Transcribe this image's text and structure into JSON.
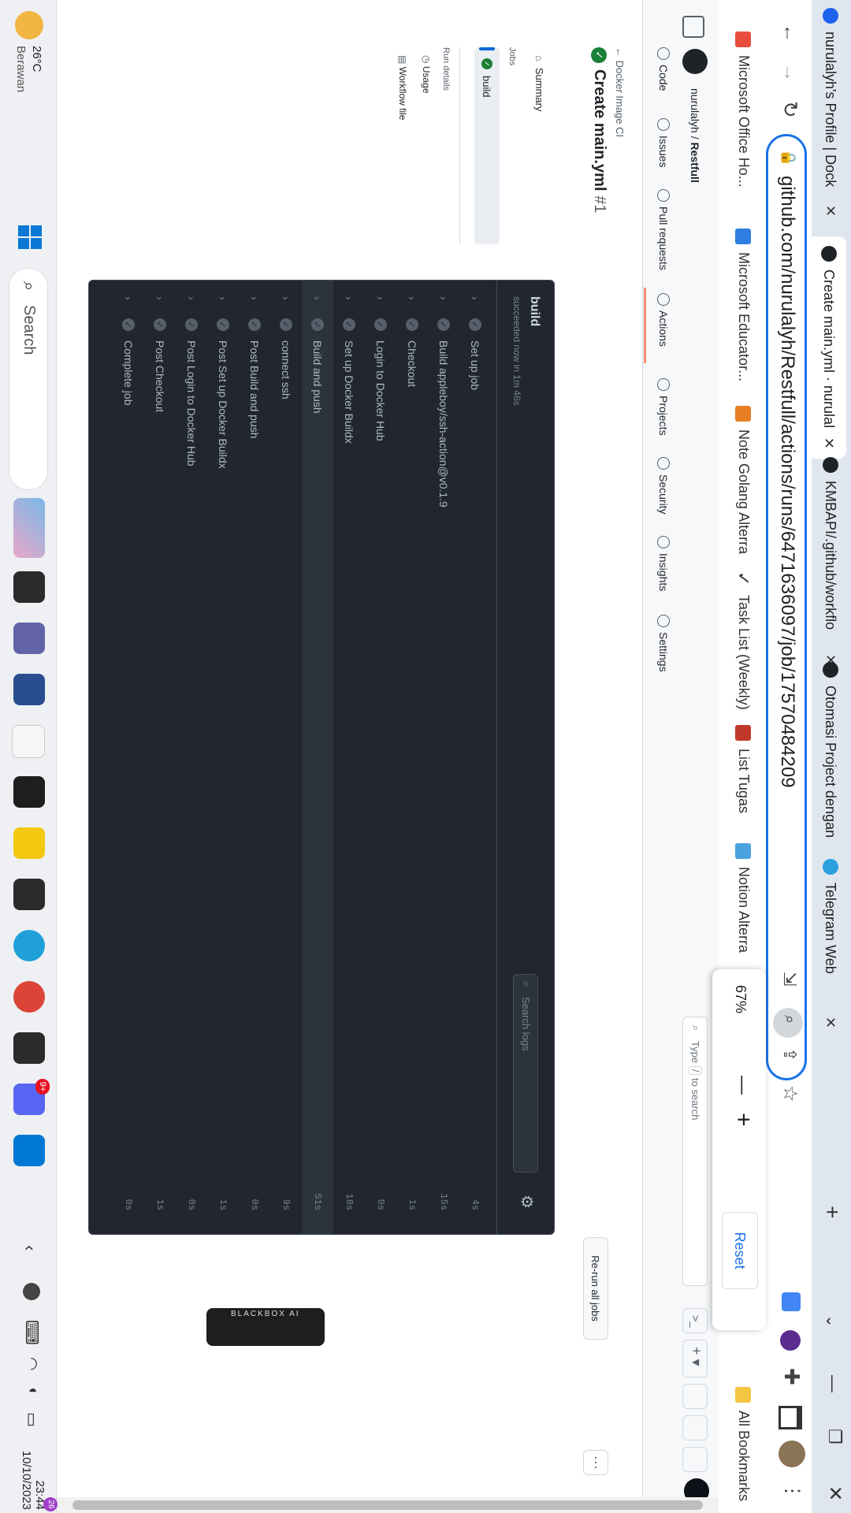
{
  "browser": {
    "tabs": [
      {
        "title": "nurulalyh's Profile | Dock",
        "active": false
      },
      {
        "title": "Create main.yml · nurulal",
        "active": true
      },
      {
        "title": "KMBAPI/.github/workflo",
        "active": false
      },
      {
        "title": "Otomasi Project dengan",
        "active": false
      },
      {
        "title": "Telegram Web",
        "active": false
      }
    ],
    "new_tab": "+",
    "url": "github.com/nurulalyh/Restfull/actions/runs/6471636097/job/17570484209",
    "bookmarks": [
      {
        "label": "Microsoft Office Ho...",
        "color": "#e74c3c"
      },
      {
        "label": "Microsoft Educator...",
        "color": "#2f7de1"
      },
      {
        "label": "Note Golang Alterra",
        "color": "#e67e22"
      },
      {
        "label": "Task List (Weekly)",
        "color": "#333333"
      },
      {
        "label": "List Tugas",
        "color": "#c0392b"
      },
      {
        "label": "Notion Alterra",
        "color": "#4aa3df"
      }
    ],
    "all_bookmarks": "All Bookmarks",
    "zoom": {
      "value": "67%",
      "minus": "—",
      "plus": "+",
      "reset": "Reset"
    }
  },
  "github": {
    "owner": "nurulalyh",
    "repo": "Restfull",
    "search_placeholder_pre": "Type",
    "search_key": "/",
    "search_placeholder_post": "to search",
    "nav": [
      "Code",
      "Issues",
      "Pull requests",
      "Actions",
      "Projects",
      "Security",
      "Insights",
      "Settings"
    ],
    "back_link": "Docker Image CI",
    "run_title": "Create main.yml",
    "run_number": "#1",
    "rerun_button": "Re-run all jobs",
    "more": "⋯",
    "sidebar": {
      "summary": "Summary",
      "jobs_heading": "Jobs",
      "job": "build",
      "run_details": "Run details",
      "usage": "Usage",
      "workflow_file": "Workflow file"
    },
    "job": {
      "name": "build",
      "status": "succeeded now in 1m 46s",
      "search_placeholder": "Search logs",
      "steps": [
        {
          "name": "Set up job",
          "duration": "4s"
        },
        {
          "name": "Build appleboy/ssh-action@v0.1.9",
          "duration": "15s"
        },
        {
          "name": "Checkout",
          "duration": "1s"
        },
        {
          "name": "Login to Docker Hub",
          "duration": "0s"
        },
        {
          "name": "Set up Docker Buildx",
          "duration": "18s"
        },
        {
          "name": "Build and push",
          "duration": "51s"
        },
        {
          "name": "connect ssh",
          "duration": "9s"
        },
        {
          "name": "Post Build and push",
          "duration": "0s"
        },
        {
          "name": "Post Set up Docker Buildx",
          "duration": "1s"
        },
        {
          "name": "Post Login to Docker Hub",
          "duration": "0s"
        },
        {
          "name": "Post Checkout",
          "duration": "1s"
        },
        {
          "name": "Complete job",
          "duration": "0s"
        }
      ]
    },
    "blackbox": "BLACKBOX AI"
  },
  "taskbar": {
    "weather_temp": "26°C",
    "weather_desc": "Berawan",
    "search": "Search",
    "time": "23:44",
    "date": "10/10/2023",
    "notif_count": "26",
    "discord_badge": "9+"
  },
  "colors": {
    "accent": "#1a73e8",
    "success": "#1a7f37",
    "log_bg": "#22272e",
    "actions_underline": "#fd8c73"
  }
}
